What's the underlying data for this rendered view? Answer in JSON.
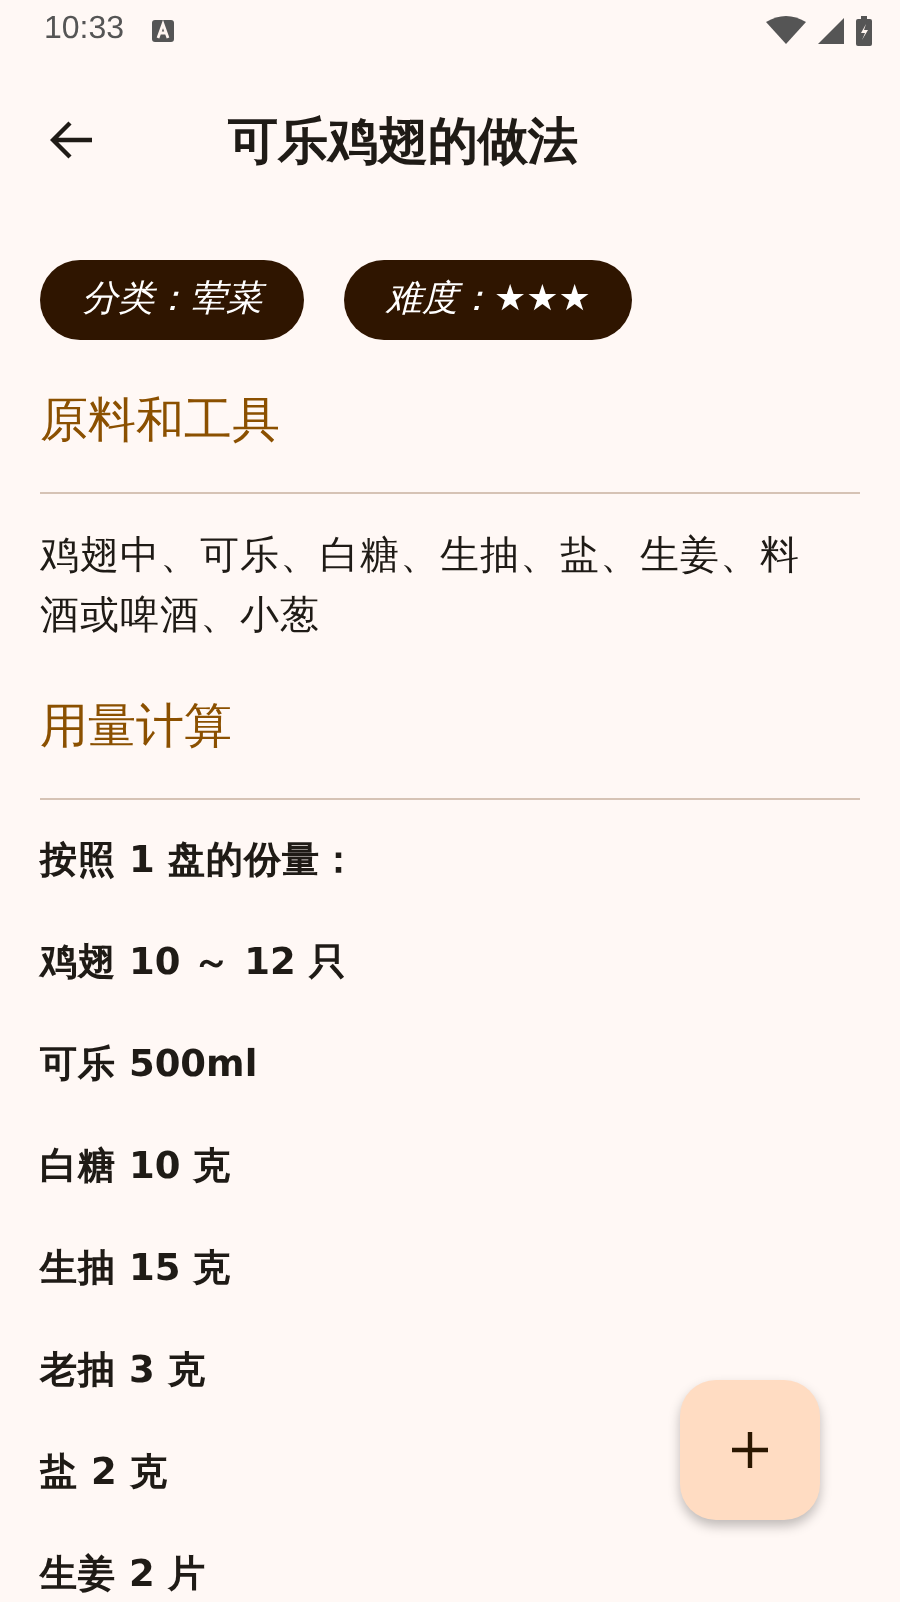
{
  "status_bar": {
    "time": "10:33"
  },
  "app_bar": {
    "title": "可乐鸡翅的做法"
  },
  "chips": [
    {
      "label": "分类：荤菜"
    },
    {
      "label": "难度：★★★"
    }
  ],
  "sections": [
    {
      "heading": "原料和工具",
      "kind": "paragraph",
      "text": "鸡翅中、可乐、白糖、生抽、盐、生姜、料酒或啤酒、小葱"
    },
    {
      "heading": "用量计算",
      "kind": "list",
      "items": [
        "按照 1 盘的份量：",
        "鸡翅 10 ～ 12 只",
        "可乐 500ml",
        "白糖 10 克",
        "生抽 15 克",
        "老抽 3 克",
        "盐 2 克",
        "生姜 2 片"
      ]
    }
  ]
}
